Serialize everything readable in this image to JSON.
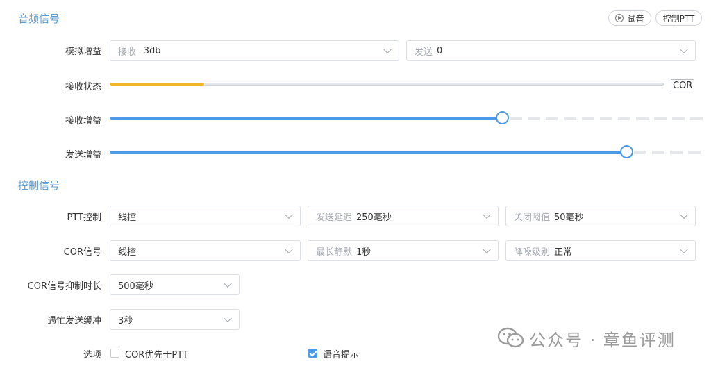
{
  "audio_section": {
    "title": "音频信号",
    "trial_button": "试音",
    "ptt_button": "控制PTT",
    "analog_gain": {
      "label": "模拟增益",
      "receive": {
        "prefix": "接收",
        "value": "-3db"
      },
      "send": {
        "prefix": "发送",
        "value": "0"
      }
    },
    "receive_status": {
      "label": "接收状态",
      "level_percent": 17,
      "badge": "COR",
      "bar_color": "#f0b429"
    },
    "receive_gain": {
      "label": "接收增益",
      "level_percent": 66
    },
    "send_gain": {
      "label": "发送增益",
      "level_percent": 87
    }
  },
  "control_section": {
    "title": "控制信号",
    "ptt_control": {
      "label": "PTT控制",
      "mode": "线控",
      "send_delay": {
        "prefix": "发送延迟",
        "value": "250毫秒"
      },
      "close_threshold": {
        "prefix": "关闭阈值",
        "value": "50毫秒"
      }
    },
    "cor_signal": {
      "label": "COR信号",
      "mode": "线控",
      "max_silence": {
        "prefix": "最长静默",
        "value": "1秒"
      },
      "noise_level": {
        "prefix": "降噪级别",
        "value": "正常"
      }
    },
    "cor_suppress": {
      "label": "COR信号抑制时长",
      "value": "500毫秒"
    },
    "busy_buffer": {
      "label": "遇忙发送缓冲",
      "value": "3秒"
    },
    "options": {
      "label": "选项",
      "cor_priority": {
        "label": "COR优先于PTT",
        "checked": false
      },
      "voice_prompt": {
        "label": "语音提示",
        "checked": true
      }
    }
  },
  "watermark": {
    "text": "公众号 · 章鱼评测"
  },
  "colors": {
    "accent": "#4a9ae8",
    "title": "#5b9bd5"
  }
}
